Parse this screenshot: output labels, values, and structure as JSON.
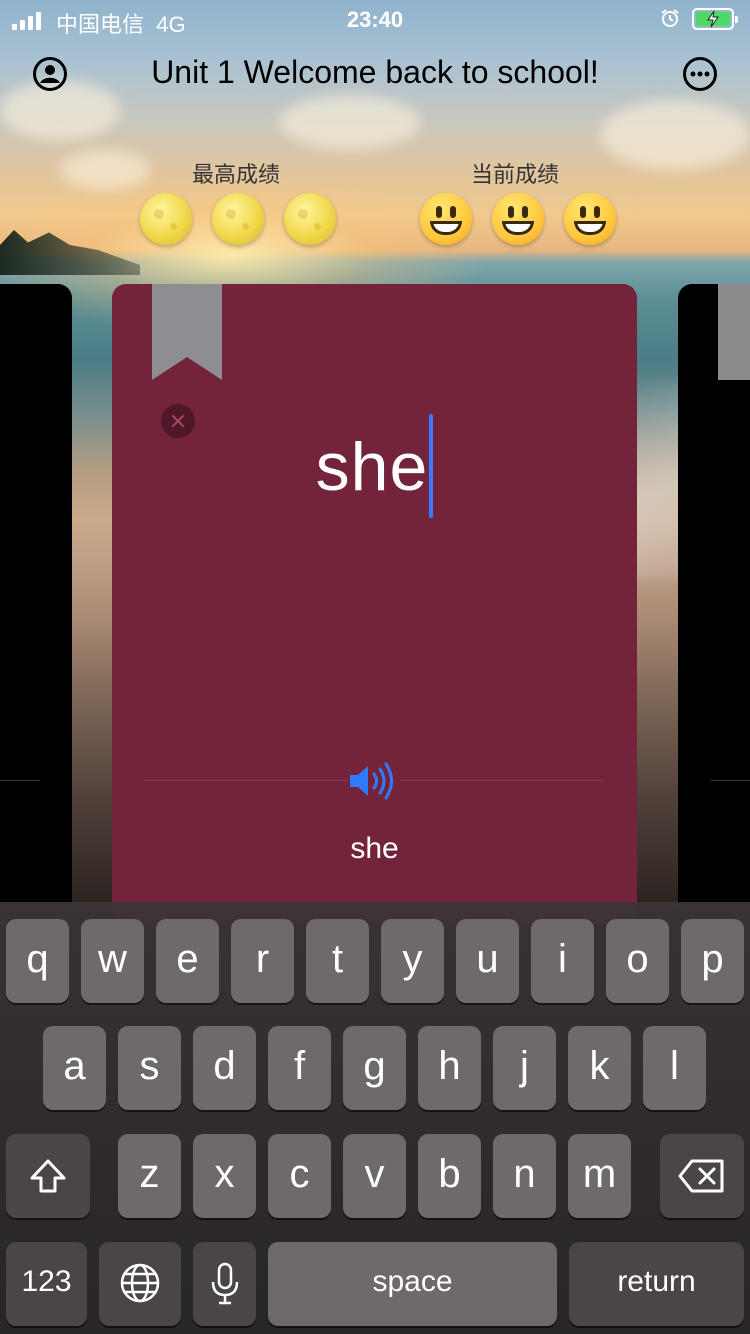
{
  "status_bar": {
    "carrier": "中国电信",
    "network": "4G",
    "time": "23:40"
  },
  "nav": {
    "title": "Unit 1 Welcome back to school!"
  },
  "scores": {
    "best_label": "最高成绩",
    "current_label": "当前成绩",
    "best_icon": "full-moon-icon",
    "current_icon": "grinning-face-icon",
    "best_count": 3,
    "current_count": 3
  },
  "card": {
    "typed_word": "she",
    "answer_word": "she",
    "color": "#74243a"
  },
  "keyboard": {
    "row1": [
      "q",
      "w",
      "e",
      "r",
      "t",
      "y",
      "u",
      "i",
      "o",
      "p"
    ],
    "row2": [
      "a",
      "s",
      "d",
      "f",
      "g",
      "h",
      "j",
      "k",
      "l"
    ],
    "row3": [
      "z",
      "x",
      "c",
      "v",
      "b",
      "n",
      "m"
    ],
    "numbers_label": "123",
    "space_label": "space",
    "return_label": "return"
  },
  "colors": {
    "caret": "#3a7bff",
    "speaker": "#2f7bff",
    "battery": "#4cd964"
  }
}
